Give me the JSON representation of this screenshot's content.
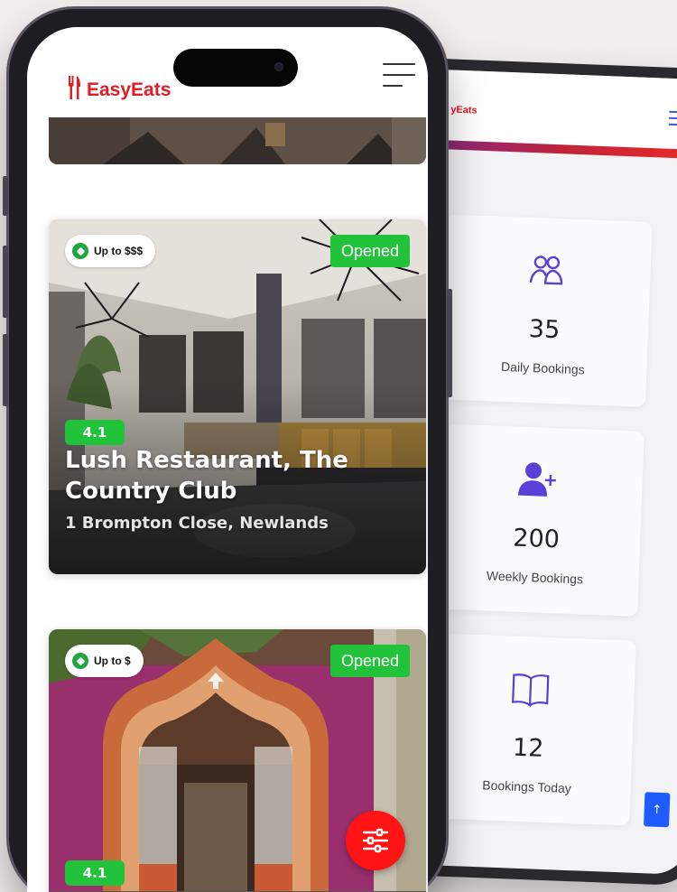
{
  "app": {
    "brand": "EasyEats",
    "brand_short": "yEats",
    "brand_color": "#e31b23"
  },
  "listing": {
    "header": {
      "logo_icon": "fork-knife-icon",
      "menu_icon": "hamburger-menu-icon"
    },
    "cards": [
      {
        "price": "Up to $$$",
        "status": "Opened",
        "rating": "4.1",
        "name": "Lush Restaurant, The Country Club",
        "address": "1 Brompton Close, Newlands"
      },
      {
        "price": "Up to $",
        "status": "Opened",
        "rating": "4.1"
      }
    ],
    "filter_button_icon": "sliders-filter-icon",
    "status_color": "#22c23a"
  },
  "dashboard": {
    "stats": [
      {
        "icon": "users-icon",
        "value": "35",
        "label": "Daily Bookings"
      },
      {
        "icon": "user-plus-icon",
        "value": "200",
        "label": "Weekly Bookings"
      },
      {
        "icon": "open-book-icon",
        "value": "12",
        "label": "Bookings Today"
      }
    ],
    "scroll_top_icon": "arrow-up-icon",
    "accent_color": "#5b3fd9"
  }
}
